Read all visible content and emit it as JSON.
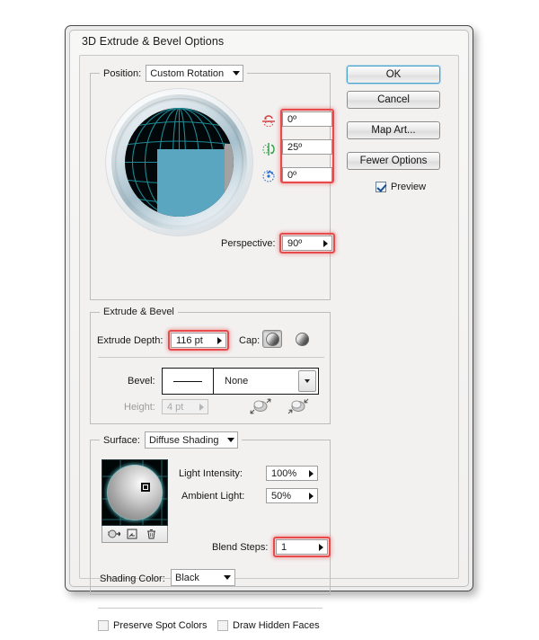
{
  "dialog": {
    "title": "3D Extrude & Bevel Options"
  },
  "buttons": {
    "ok": "OK",
    "cancel": "Cancel",
    "map_art": "Map Art...",
    "fewer_options": "Fewer Options"
  },
  "preview_checkbox": {
    "label": "Preview",
    "checked": true
  },
  "position_group": {
    "label": "Position:",
    "value": "Custom Rotation",
    "rotation": {
      "x_axis": {
        "icon": "rotate-x-axis-icon",
        "value": "0º"
      },
      "y_axis": {
        "icon": "rotate-y-axis-icon",
        "value": "25º"
      },
      "z_axis": {
        "icon": "rotate-z-axis-icon",
        "value": "0º"
      }
    },
    "perspective": {
      "label": "Perspective:",
      "value": "90º"
    }
  },
  "extrude_group": {
    "label": "Extrude & Bevel",
    "extrude_depth": {
      "label": "Extrude Depth:",
      "value": "116 pt"
    },
    "cap": {
      "label": "Cap:",
      "selected": "solid-cap",
      "options": [
        "solid-cap",
        "hollow-cap"
      ]
    },
    "bevel": {
      "label": "Bevel:",
      "value": "None"
    },
    "height": {
      "label": "Height:",
      "value": "4 pt",
      "disabled": true
    },
    "bevel_direction": {
      "out": "bevel-extent-out-icon",
      "in": "bevel-extent-in-icon"
    }
  },
  "surface_group": {
    "label": "Surface:",
    "value": "Diffuse Shading",
    "light_intensity": {
      "label": "Light Intensity:",
      "value": "100%"
    },
    "ambient_light": {
      "label": "Ambient Light:",
      "value": "50%"
    },
    "blend_steps": {
      "label": "Blend Steps:",
      "value": "1"
    },
    "shading_color": {
      "label": "Shading Color:",
      "value": "Black"
    },
    "light_tools": [
      "new-light-icon",
      "duplicate-light-icon",
      "delete-light-icon"
    ],
    "preserve_spot_colors": {
      "label": "Preserve Spot Colors",
      "checked": false
    },
    "draw_hidden_faces": {
      "label": "Draw Hidden Faces",
      "checked": false
    }
  },
  "colors": {
    "highlight_red": "#e8494a",
    "front_face_blue": "#5aa6c0",
    "side_face_gray": "#a2a2a2",
    "globe_background": "#020709",
    "globe_grid_teal": "#1d8a96",
    "dialog_background": "#f2f1f0",
    "accent_blue": "#4da0c8"
  }
}
